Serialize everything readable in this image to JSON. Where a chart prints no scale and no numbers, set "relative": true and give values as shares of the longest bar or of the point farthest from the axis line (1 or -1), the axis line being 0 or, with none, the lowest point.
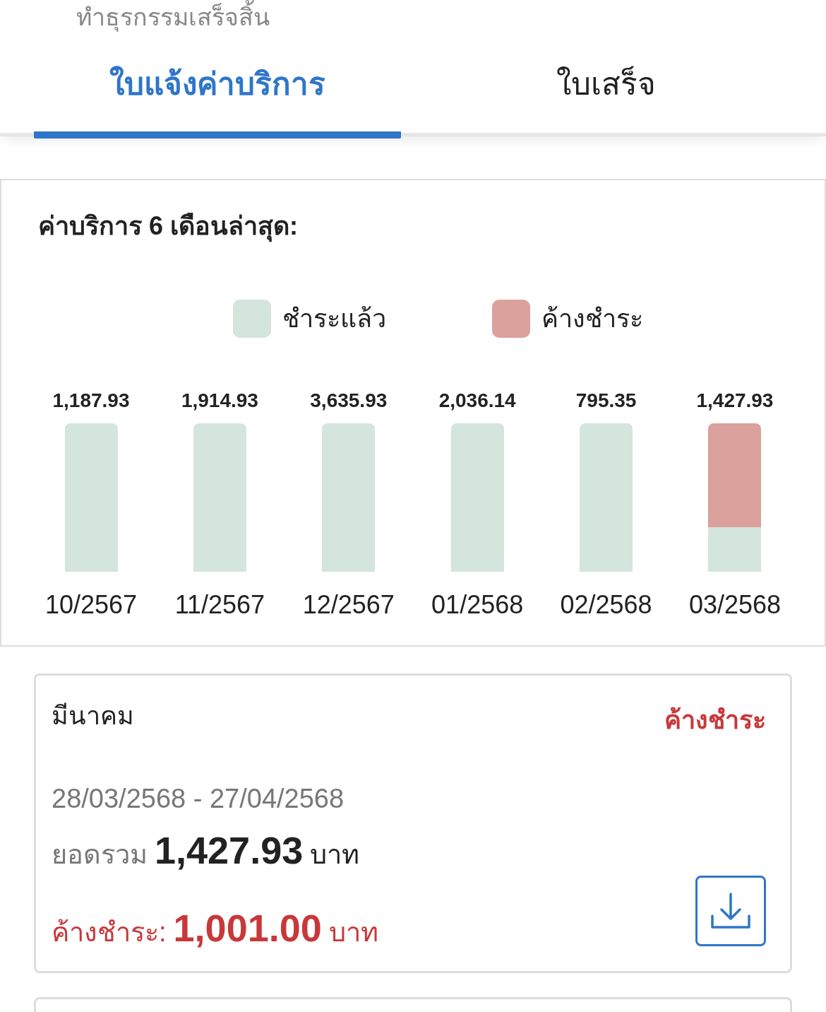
{
  "header": {
    "title": "ทำธุรกรรมเสร็จสิ้น"
  },
  "tabs": [
    {
      "label": "ใบแจ้งค่าบริการ",
      "selected": true
    },
    {
      "label": "ใบเสร็จ",
      "selected": false
    }
  ],
  "chart_card": {
    "title": "ค่าบริการ 6 เดือนล่าสุด:",
    "chart_data": {
      "type": "bar",
      "stacked": true,
      "relative": true,
      "categories": [
        "10/2567",
        "11/2567",
        "12/2567",
        "01/2568",
        "02/2568",
        "03/2568"
      ],
      "series": [
        {
          "name": "ชำระแล้ว",
          "color": "#d3e5dd",
          "values": [
            1,
            1,
            1,
            1,
            1,
            0.299
          ]
        },
        {
          "name": "ค้างชำระ",
          "color": "#dba19d",
          "values": [
            0,
            0,
            0,
            0,
            0,
            0.701
          ]
        }
      ],
      "value_labels": [
        "1,187.93",
        "1,914.93",
        "3,635.93",
        "2,036.14",
        "795.35",
        "1,427.93"
      ]
    }
  },
  "invoices": [
    {
      "month": "มีนาคม",
      "status": "ค้างชำระ",
      "outstanding": true,
      "period": "28/03/2568 - 27/04/2568",
      "total_label": "ยอดรวม",
      "total": "1,427.93",
      "total_unit": "บาท",
      "due_label": "ค้างชำระ:",
      "due": "1,001.00",
      "due_unit": "บาท"
    }
  ]
}
